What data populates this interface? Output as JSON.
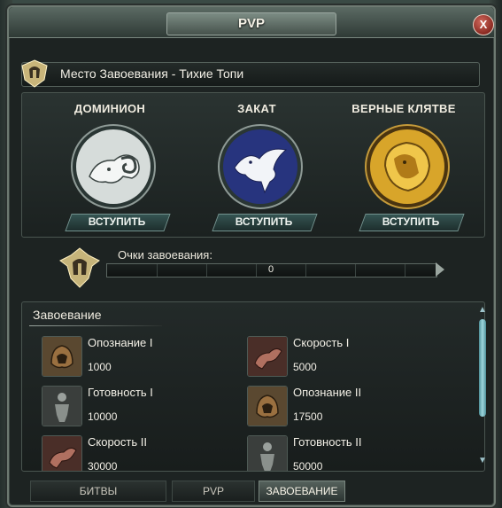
{
  "window": {
    "title": "PVP",
    "close_label": "X"
  },
  "location": {
    "text": "Место Завоевания - Тихие Топи"
  },
  "factions": [
    {
      "name": "ДОМИНИОН",
      "join_label": "ВСТУПИТЬ",
      "emblem": "ram-icon",
      "color": "#c8d2d0"
    },
    {
      "name": "ЗАКАТ",
      "join_label": "ВСТУПИТЬ",
      "emblem": "raven-icon",
      "color": "#3b4a9a"
    },
    {
      "name": "ВЕРНЫЕ КЛЯТВЕ",
      "join_label": "ВСТУПИТЬ",
      "emblem": "lion-icon",
      "color": "#d4a020"
    }
  ],
  "points": {
    "label": "Очки завоевания:",
    "value": "0"
  },
  "conquest": {
    "title": "Завоевание",
    "items": [
      {
        "name": "Опознание I",
        "cost": "1000",
        "icon": "helm-icon"
      },
      {
        "name": "Скорость I",
        "cost": "5000",
        "icon": "horse-icon"
      },
      {
        "name": "Готовность I",
        "cost": "10000",
        "icon": "figure-icon"
      },
      {
        "name": "Опознание II",
        "cost": "17500",
        "icon": "helm-icon"
      },
      {
        "name": "Скорость II",
        "cost": "30000",
        "icon": "horse-icon"
      },
      {
        "name": "Готовность II",
        "cost": "50000",
        "icon": "figure-icon"
      }
    ]
  },
  "tabs": [
    {
      "label": "БИТВЫ",
      "active": false
    },
    {
      "label": "PVP",
      "active": false
    },
    {
      "label": "ЗАВОЕВАНИЕ",
      "active": true
    }
  ]
}
